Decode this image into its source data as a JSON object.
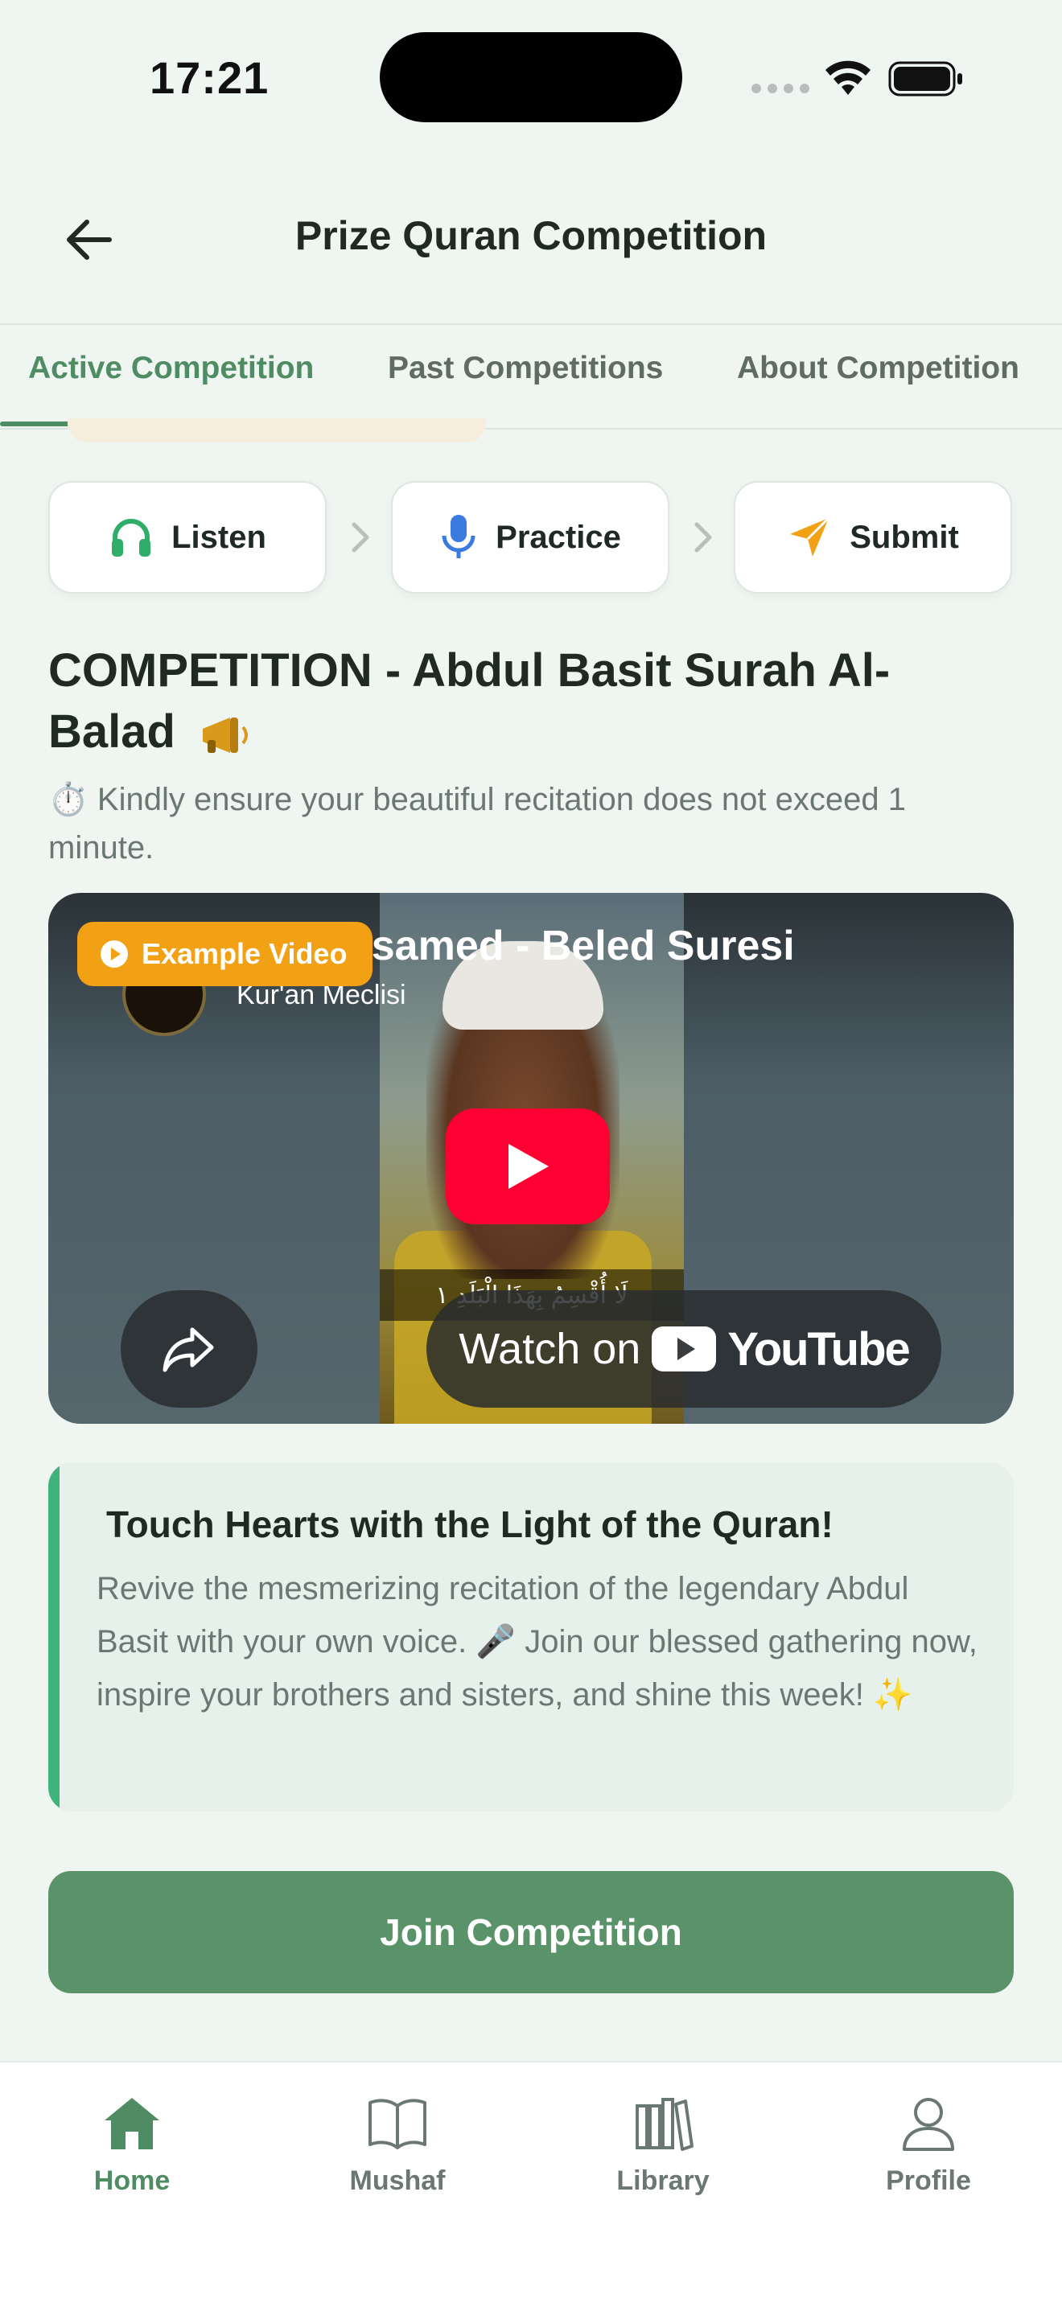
{
  "status_bar": {
    "time": "17:21"
  },
  "header": {
    "title": "Prize Quran Competition"
  },
  "tabs": [
    {
      "label": "Active Competition",
      "active": true
    },
    {
      "label": "Past Competitions",
      "active": false
    },
    {
      "label": "About Competition",
      "active": false
    }
  ],
  "steps": [
    {
      "label": "Listen",
      "icon": "headphones-icon",
      "color": "#2fae6a"
    },
    {
      "label": "Practice",
      "icon": "microphone-icon",
      "color": "#3a7be0"
    },
    {
      "label": "Submit",
      "icon": "send-icon",
      "color": "#f2a115"
    }
  ],
  "competition": {
    "title": "COMPETITION - Abdul Basit Surah Al-Balad",
    "description": "⏱️ Kindly ensure your beautiful recitation does not exceed 1 minute."
  },
  "video": {
    "badge": "Example Video",
    "title": "Abdussamed - Beled Suresi",
    "channel": "Kur'an Meclisi",
    "arabic_caption": "لَا أُقْسِمُ بِهَذَا الْبَلَدِ ١",
    "watch_label": "Watch on",
    "youtube_word": "YouTube"
  },
  "promo": {
    "title": "Touch Hearts with the Light of the Quran!",
    "text": "Revive the mesmerizing recitation of the legendary Abdul Basit with your own voice. 🎤 Join our blessed gathering now, inspire your brothers and sisters, and shine this week! ✨"
  },
  "join_button": {
    "label": "Join Competition"
  },
  "bottom_nav": [
    {
      "label": "Home",
      "icon": "home-icon",
      "active": true
    },
    {
      "label": "Mushaf",
      "icon": "book-icon",
      "active": false
    },
    {
      "label": "Library",
      "icon": "library-icon",
      "active": false
    },
    {
      "label": "Profile",
      "icon": "person-icon",
      "active": false
    }
  ],
  "colors": {
    "accent": "#4f8c63",
    "button": "#5a9369",
    "badge": "#f2a115",
    "promo_border": "#3eb37a"
  }
}
